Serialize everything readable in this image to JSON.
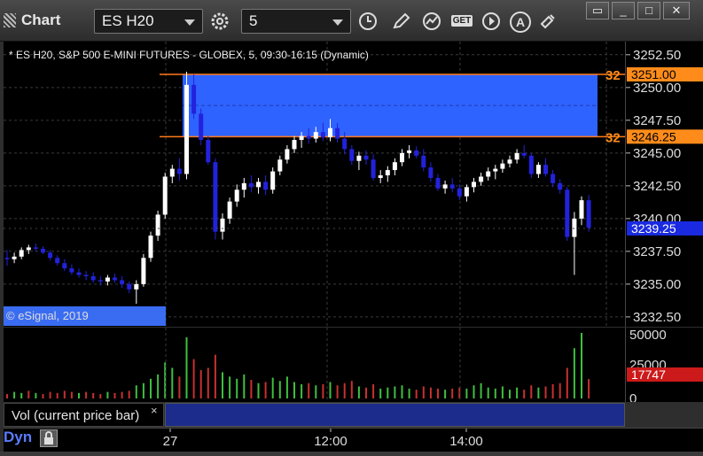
{
  "toolbar": {
    "title": "Chart",
    "symbol_value": "ES H20",
    "interval_value": "5",
    "icons": [
      "gear-icon",
      "clock-icon",
      "pencil-icon",
      "study-icon",
      "get-icon",
      "play-icon",
      "a-icon",
      "link-icon"
    ],
    "get_label": "GET",
    "a_label": "A",
    "window_buttons": [
      "restore",
      "minimize",
      "maximize",
      "close"
    ]
  },
  "header": {
    "description": "* ES H20, S&P 500 E-MINI FUTURES - GLOBEX, 5, 09:30-16:15 (Dynamic)"
  },
  "copyright": "© eSignal, 2019",
  "colors": {
    "up": "#ffffff",
    "down": "#2222dd",
    "zone": "#2f63ff",
    "zone_line": "#ff7a1a",
    "vol_up": "#3fbf3f",
    "vol_down": "#c83030"
  },
  "price_axis": {
    "ticks": [
      "3252.50",
      "3250.00",
      "3247.50",
      "3245.00",
      "3242.50",
      "3240.00",
      "3237.50",
      "3235.00",
      "3232.50"
    ],
    "marker_high_label": "3251.00",
    "marker_low_label": "3246.25",
    "marker_current_label": "3239.25",
    "marker_side_label_high": "32",
    "marker_side_label_low": "32"
  },
  "volume_axis": {
    "ticks": [
      "50000",
      "25000",
      "0"
    ],
    "current_volume": "17747"
  },
  "time_axis": {
    "labels": [
      "27",
      "12:00",
      "14:00"
    ]
  },
  "volume_legend": "Vol (current price bar)",
  "volume_close": "×",
  "bottom": {
    "mode_label": "Dyn"
  },
  "chart_data": {
    "type": "candlestick",
    "symbol": "ES H20",
    "interval": "5",
    "ylim": [
      3231.75,
      3253.5
    ],
    "zone": {
      "high": 3251.0,
      "low": 3246.25
    },
    "current_price": 3239.25,
    "candles": [
      [
        3237.0,
        3237.6,
        3236.4,
        3236.9
      ],
      [
        3236.9,
        3237.4,
        3236.6,
        3237.1
      ],
      [
        3237.1,
        3237.8,
        3236.9,
        3237.6
      ],
      [
        3237.6,
        3238.0,
        3237.3,
        3237.8
      ],
      [
        3237.8,
        3238.1,
        3237.5,
        3237.7
      ],
      [
        3237.7,
        3237.9,
        3237.3,
        3237.4
      ],
      [
        3237.4,
        3237.6,
        3236.8,
        3237.0
      ],
      [
        3237.0,
        3237.2,
        3236.4,
        3236.6
      ],
      [
        3236.6,
        3236.9,
        3236.0,
        3236.2
      ],
      [
        3236.2,
        3236.5,
        3235.7,
        3235.9
      ],
      [
        3235.9,
        3236.2,
        3235.5,
        3235.7
      ],
      [
        3235.7,
        3236.0,
        3235.3,
        3235.6
      ],
      [
        3235.6,
        3235.9,
        3235.1,
        3235.3
      ],
      [
        3235.3,
        3235.6,
        3234.9,
        3235.2
      ],
      [
        3235.2,
        3235.7,
        3234.9,
        3235.5
      ],
      [
        3235.5,
        3235.8,
        3235.1,
        3235.3
      ],
      [
        3235.3,
        3235.6,
        3234.7,
        3235.0
      ],
      [
        3235.0,
        3235.2,
        3234.3,
        3234.6
      ],
      [
        3234.6,
        3235.3,
        3233.5,
        3235.0
      ],
      [
        3235.0,
        3237.3,
        3234.8,
        3237.0
      ],
      [
        3237.0,
        3239.0,
        3236.7,
        3238.7
      ],
      [
        3238.7,
        3240.6,
        3238.3,
        3240.3
      ],
      [
        3240.3,
        3243.5,
        3240.0,
        3243.2
      ],
      [
        3243.2,
        3244.1,
        3242.7,
        3243.8
      ],
      [
        3243.8,
        3244.6,
        3242.9,
        3243.4
      ],
      [
        3243.4,
        3251.2,
        3243.0,
        3250.2
      ],
      [
        3250.2,
        3251.0,
        3247.6,
        3248.0
      ],
      [
        3248.0,
        3248.4,
        3245.6,
        3246.0
      ],
      [
        3246.0,
        3246.3,
        3244.1,
        3244.3
      ],
      [
        3244.3,
        3244.6,
        3238.4,
        3239.0
      ],
      [
        3239.0,
        3240.4,
        3238.4,
        3240.0
      ],
      [
        3240.0,
        3241.6,
        3239.6,
        3241.3
      ],
      [
        3241.3,
        3242.6,
        3240.9,
        3242.2
      ],
      [
        3242.2,
        3243.1,
        3241.6,
        3242.7
      ],
      [
        3242.7,
        3243.3,
        3242.0,
        3242.4
      ],
      [
        3242.4,
        3243.1,
        3241.9,
        3242.8
      ],
      [
        3242.8,
        3243.3,
        3241.8,
        3242.2
      ],
      [
        3242.2,
        3243.9,
        3241.9,
        3243.6
      ],
      [
        3243.6,
        3244.8,
        3243.3,
        3244.5
      ],
      [
        3244.5,
        3245.6,
        3244.2,
        3245.3
      ],
      [
        3245.3,
        3246.3,
        3245.0,
        3246.0
      ],
      [
        3246.0,
        3246.6,
        3245.4,
        3246.3
      ],
      [
        3246.3,
        3246.9,
        3245.7,
        3246.1
      ],
      [
        3246.1,
        3247.0,
        3245.8,
        3246.6
      ],
      [
        3246.6,
        3247.3,
        3245.9,
        3246.2
      ],
      [
        3246.2,
        3247.6,
        3245.9,
        3246.9
      ],
      [
        3246.9,
        3247.3,
        3245.8,
        3246.1
      ],
      [
        3246.1,
        3246.6,
        3244.9,
        3245.3
      ],
      [
        3245.3,
        3245.6,
        3244.1,
        3244.4
      ],
      [
        3244.4,
        3245.1,
        3243.7,
        3244.8
      ],
      [
        3244.8,
        3245.2,
        3244.1,
        3244.5
      ],
      [
        3244.5,
        3244.9,
        3242.9,
        3243.1
      ],
      [
        3243.1,
        3243.7,
        3242.7,
        3243.3
      ],
      [
        3243.3,
        3244.0,
        3242.8,
        3243.7
      ],
      [
        3243.7,
        3244.6,
        3243.3,
        3244.3
      ],
      [
        3244.3,
        3245.3,
        3244.0,
        3245.0
      ],
      [
        3245.0,
        3245.6,
        3244.6,
        3245.2
      ],
      [
        3245.2,
        3245.5,
        3244.6,
        3244.8
      ],
      [
        3244.8,
        3245.3,
        3243.6,
        3243.9
      ],
      [
        3243.9,
        3244.3,
        3242.8,
        3243.1
      ],
      [
        3243.1,
        3243.4,
        3242.1,
        3242.3
      ],
      [
        3242.3,
        3242.9,
        3241.9,
        3242.6
      ],
      [
        3242.6,
        3243.1,
        3242.0,
        3242.3
      ],
      [
        3242.3,
        3242.6,
        3241.4,
        3241.7
      ],
      [
        3241.7,
        3242.6,
        3241.3,
        3242.4
      ],
      [
        3242.4,
        3243.1,
        3242.0,
        3242.8
      ],
      [
        3242.8,
        3243.5,
        3242.5,
        3243.2
      ],
      [
        3243.2,
        3243.9,
        3242.9,
        3243.6
      ],
      [
        3243.6,
        3244.1,
        3243.0,
        3243.8
      ],
      [
        3243.8,
        3244.5,
        3243.5,
        3244.2
      ],
      [
        3244.2,
        3244.8,
        3243.9,
        3244.5
      ],
      [
        3244.5,
        3245.3,
        3244.2,
        3245.0
      ],
      [
        3245.0,
        3245.6,
        3244.6,
        3244.8
      ],
      [
        3244.8,
        3245.0,
        3243.1,
        3243.4
      ],
      [
        3243.4,
        3244.3,
        3243.1,
        3244.1
      ],
      [
        3244.1,
        3244.6,
        3243.2,
        3243.4
      ],
      [
        3243.4,
        3243.7,
        3242.4,
        3242.7
      ],
      [
        3242.7,
        3243.0,
        3241.9,
        3242.2
      ],
      [
        3242.2,
        3242.4,
        3238.3,
        3238.6
      ],
      [
        3238.6,
        3240.5,
        3235.7,
        3240.0
      ],
      [
        3240.0,
        3241.7,
        3239.5,
        3241.4
      ],
      [
        3241.4,
        3241.8,
        3239.0,
        3239.3
      ]
    ],
    "volumes": [
      [
        4000,
        "down"
      ],
      [
        6000,
        "up"
      ],
      [
        5000,
        "up"
      ],
      [
        7000,
        "down"
      ],
      [
        5000,
        "up"
      ],
      [
        4000,
        "down"
      ],
      [
        6000,
        "down"
      ],
      [
        5000,
        "down"
      ],
      [
        7000,
        "down"
      ],
      [
        6000,
        "down"
      ],
      [
        5000,
        "up"
      ],
      [
        6000,
        "down"
      ],
      [
        5000,
        "down"
      ],
      [
        4000,
        "down"
      ],
      [
        6000,
        "up"
      ],
      [
        5000,
        "down"
      ],
      [
        6000,
        "down"
      ],
      [
        7000,
        "down"
      ],
      [
        12000,
        "up"
      ],
      [
        14000,
        "up"
      ],
      [
        18000,
        "up"
      ],
      [
        22000,
        "up"
      ],
      [
        33000,
        "up"
      ],
      [
        28000,
        "up"
      ],
      [
        20000,
        "down"
      ],
      [
        56000,
        "up"
      ],
      [
        36000,
        "down"
      ],
      [
        26000,
        "down"
      ],
      [
        28000,
        "down"
      ],
      [
        40000,
        "down"
      ],
      [
        24000,
        "up"
      ],
      [
        20000,
        "up"
      ],
      [
        18000,
        "up"
      ],
      [
        22000,
        "up"
      ],
      [
        17000,
        "down"
      ],
      [
        14000,
        "up"
      ],
      [
        15000,
        "down"
      ],
      [
        19000,
        "up"
      ],
      [
        16000,
        "up"
      ],
      [
        20000,
        "up"
      ],
      [
        15000,
        "up"
      ],
      [
        13000,
        "up"
      ],
      [
        14000,
        "down"
      ],
      [
        12000,
        "up"
      ],
      [
        13000,
        "down"
      ],
      [
        15000,
        "up"
      ],
      [
        12000,
        "down"
      ],
      [
        14000,
        "down"
      ],
      [
        16000,
        "down"
      ],
      [
        11000,
        "up"
      ],
      [
        10000,
        "down"
      ],
      [
        13000,
        "down"
      ],
      [
        9000,
        "up"
      ],
      [
        10000,
        "up"
      ],
      [
        11000,
        "up"
      ],
      [
        12000,
        "up"
      ],
      [
        9000,
        "up"
      ],
      [
        8000,
        "down"
      ],
      [
        11000,
        "down"
      ],
      [
        10000,
        "down"
      ],
      [
        9000,
        "down"
      ],
      [
        8000,
        "up"
      ],
      [
        9000,
        "down"
      ],
      [
        10000,
        "down"
      ],
      [
        9000,
        "up"
      ],
      [
        12000,
        "up"
      ],
      [
        14000,
        "up"
      ],
      [
        10000,
        "up"
      ],
      [
        9000,
        "up"
      ],
      [
        11000,
        "up"
      ],
      [
        8000,
        "up"
      ],
      [
        10000,
        "up"
      ],
      [
        8000,
        "down"
      ],
      [
        12000,
        "down"
      ],
      [
        10000,
        "up"
      ],
      [
        11000,
        "down"
      ],
      [
        13000,
        "down"
      ],
      [
        14000,
        "down"
      ],
      [
        28000,
        "down"
      ],
      [
        46000,
        "up"
      ],
      [
        60000,
        "up"
      ],
      [
        17747,
        "down"
      ]
    ]
  }
}
